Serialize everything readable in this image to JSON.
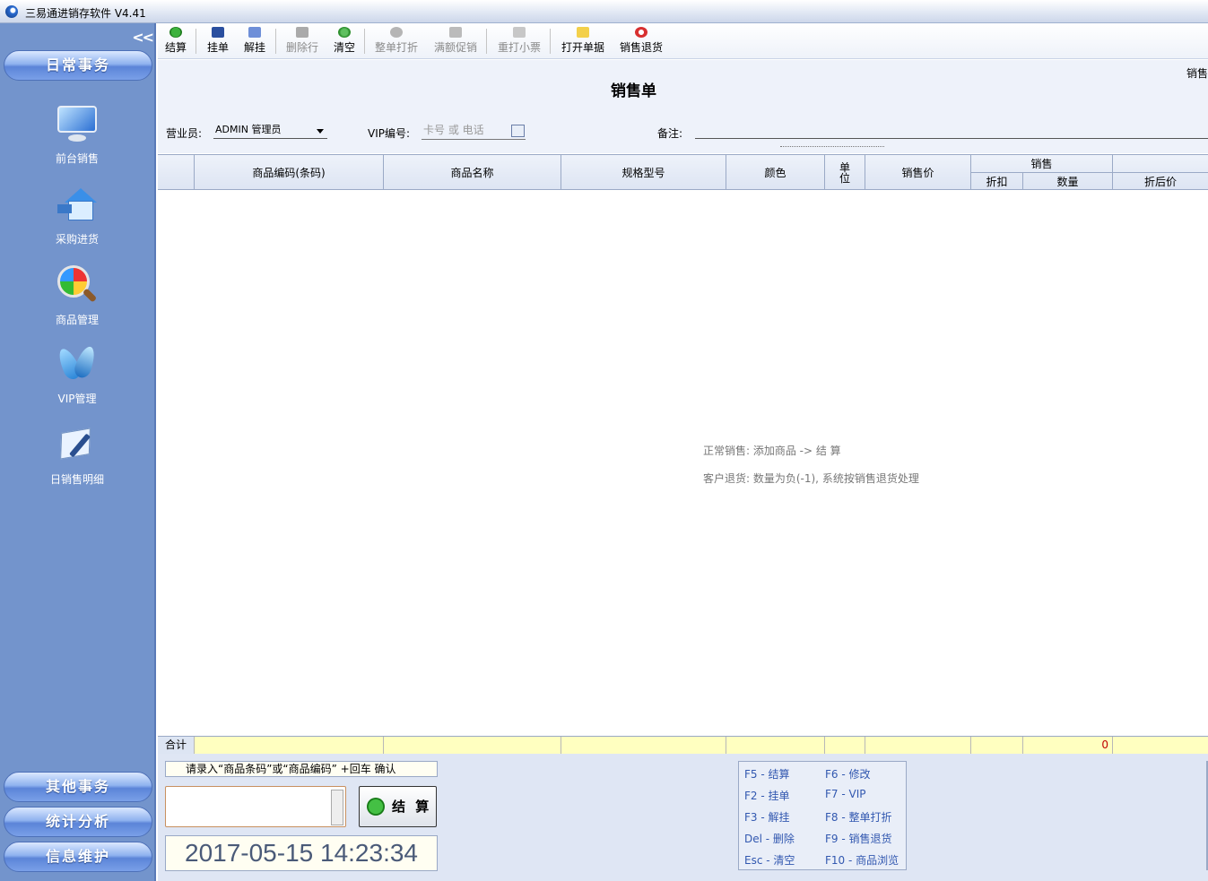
{
  "window": {
    "title": "三易通进销存软件 V4.41"
  },
  "sidebar": {
    "collapse": "<<",
    "section_top": "日常事务",
    "items": [
      {
        "label": "前台销售",
        "icon": "monitor-icon"
      },
      {
        "label": "采购进货",
        "icon": "house-icon"
      },
      {
        "label": "商品管理",
        "icon": "magnifier-icon"
      },
      {
        "label": "VIP管理",
        "icon": "vip-icon"
      },
      {
        "label": "日销售明细",
        "icon": "document-icon"
      }
    ],
    "sections_bottom": [
      "其他事务",
      "统计分析",
      "信息维护"
    ]
  },
  "toolbar": {
    "buttons": [
      {
        "label": "结算",
        "enabled": true
      },
      {
        "label": "挂单",
        "enabled": true
      },
      {
        "label": "解挂",
        "enabled": true
      },
      {
        "label": "删除行",
        "enabled": false
      },
      {
        "label": "清空",
        "enabled": true
      },
      {
        "label": "整单打折",
        "enabled": false
      },
      {
        "label": "满额促销",
        "enabled": false
      },
      {
        "label": "重打小票",
        "enabled": false
      },
      {
        "label": "打开单据",
        "enabled": true
      },
      {
        "label": "销售退货",
        "enabled": true
      }
    ]
  },
  "form": {
    "doc_title": "销售单",
    "corner_label": "销售",
    "salesperson_label": "营业员:",
    "salesperson_value": "ADMIN 管理员",
    "vip_label": "VIP编号:",
    "vip_placeholder": "卡号 或 电话",
    "remark_label": "备注:"
  },
  "grid": {
    "columns": [
      "商品编码(条码)",
      "商品名称",
      "规格型号",
      "颜色",
      "单位",
      "销售价"
    ],
    "unit_label": [
      "单",
      "位"
    ],
    "group_label": "销售",
    "group_columns": [
      "折扣",
      "数量"
    ],
    "after_discount": "折后价",
    "hints": [
      "正常销售: 添加商品 -> 结 算",
      "客户退货: 数量为负(-1), 系统按销售退货处理"
    ],
    "total_label": "合计",
    "total_qty": "0"
  },
  "bottom": {
    "scan_hint": "请录入“商品条码”或“商品编码” +回车 确认",
    "pay_label": "结 算",
    "datetime": "2017-05-15 14:23:34",
    "shortcuts": [
      [
        "F5 - 结算",
        "F6 - 修改"
      ],
      [
        "F2 - 挂单",
        "F7 - VIP"
      ],
      [
        "F3 - 解挂",
        "F8 - 整单打折"
      ],
      [
        "Del - 删除",
        "F9 - 销售退货"
      ],
      [
        "Esc - 清空",
        "F10 - 商品浏览"
      ]
    ]
  },
  "colors": {
    "sidebar": "#7394cc",
    "header": "#eef2fa",
    "total_row": "#ffffc0",
    "shortcut_text": "#3258b0"
  }
}
